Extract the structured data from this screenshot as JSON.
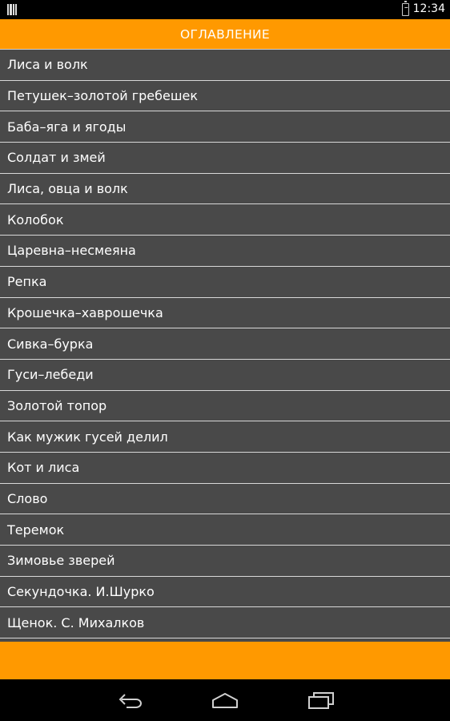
{
  "status_bar": {
    "time": "12:34",
    "notification_icon": "barcode-icon",
    "battery_icon": "battery-charging-icon"
  },
  "header": {
    "title": "ОГЛАВЛЕНИЕ"
  },
  "list": {
    "items": [
      "Лиса и волк",
      "Петушек–золотой гребешек",
      "Баба–яга и ягоды",
      "Солдат и змей",
      "Лиса, овца и волк",
      "Колобок",
      "Царевна–несмеяна",
      "Репка",
      "Крошечка–хаврошечка",
      "Сивка–бурка",
      "Гуси–лебеди",
      "Золотой топор",
      "Как мужик гусей делил",
      "Кот и лиса",
      "Слово",
      "Теремок",
      "Зимовье зверей",
      "Секундочка. И.Шурко",
      "Щенок. С. Михалков"
    ]
  },
  "nav_bar": {
    "back_icon": "back-icon",
    "home_icon": "home-icon",
    "recents_icon": "recents-icon"
  },
  "colors": {
    "accent": "#ff9900",
    "list_background": "#494949",
    "divider": "#d8d8d8",
    "text": "#ffffff"
  }
}
